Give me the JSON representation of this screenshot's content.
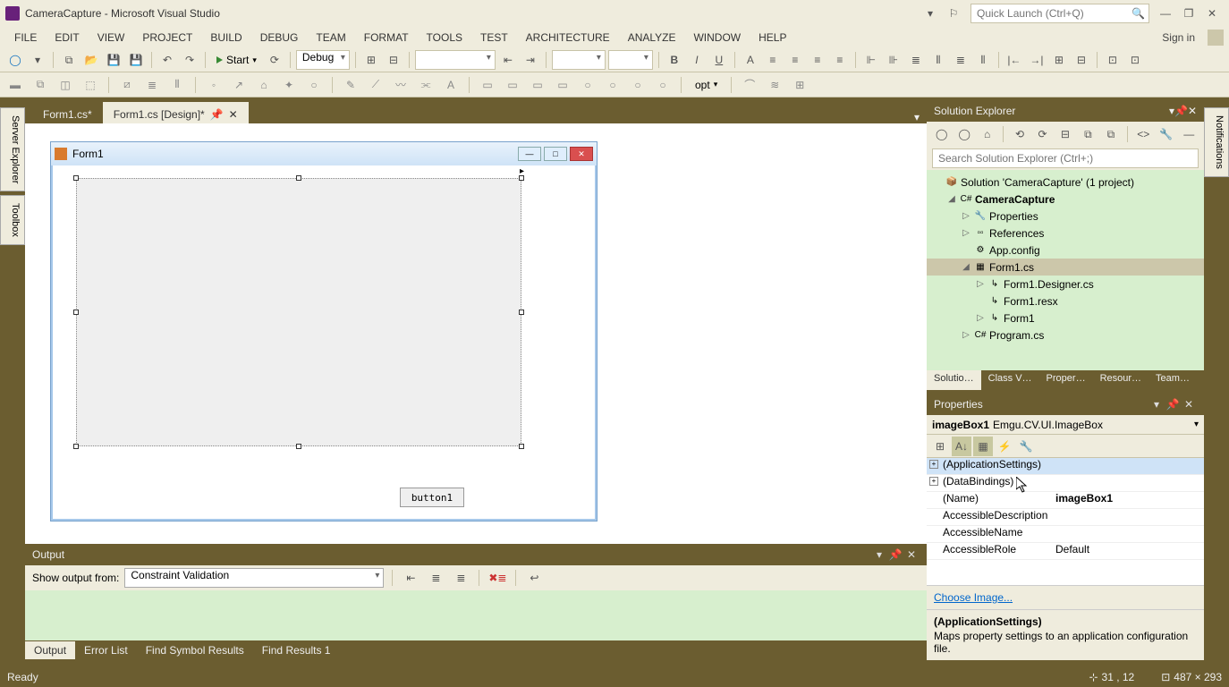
{
  "title": "CameraCapture - Microsoft Visual Studio",
  "quickLaunch": "Quick Launch (Ctrl+Q)",
  "signIn": "Sign in",
  "menu": [
    "FILE",
    "EDIT",
    "VIEW",
    "PROJECT",
    "BUILD",
    "DEBUG",
    "TEAM",
    "FORMAT",
    "TOOLS",
    "TEST",
    "ARCHITECTURE",
    "ANALYZE",
    "WINDOW",
    "HELP"
  ],
  "startLabel": "Start",
  "configCombo": "Debug",
  "optLabel": "opt",
  "sideTabs": {
    "server": "Server Explorer",
    "toolbox": "Toolbox",
    "notif": "Notifications"
  },
  "docTabs": [
    {
      "label": "Form1.cs*",
      "active": false
    },
    {
      "label": "Form1.cs [Design]*",
      "active": true
    }
  ],
  "form": {
    "title": "Form1",
    "button1": "button1"
  },
  "outputPanel": {
    "title": "Output",
    "showFrom": "Show output from:",
    "combo": "Constraint Validation"
  },
  "bottomTabs": [
    "Output",
    "Error List",
    "Find Symbol Results",
    "Find Results 1"
  ],
  "solutionExplorer": {
    "title": "Solution Explorer",
    "searchPlaceholder": "Search Solution Explorer (Ctrl+;)",
    "tree": [
      {
        "indent": 0,
        "exp": "",
        "icon": "📦",
        "label": "Solution 'CameraCapture' (1 project)",
        "bold": false,
        "sel": false
      },
      {
        "indent": 1,
        "exp": "◢",
        "icon": "C#",
        "label": "CameraCapture",
        "bold": true,
        "sel": false
      },
      {
        "indent": 2,
        "exp": "▷",
        "icon": "🔧",
        "label": "Properties",
        "bold": false,
        "sel": false
      },
      {
        "indent": 2,
        "exp": "▷",
        "icon": "▫▫",
        "label": "References",
        "bold": false,
        "sel": false
      },
      {
        "indent": 2,
        "exp": "",
        "icon": "⚙",
        "label": "App.config",
        "bold": false,
        "sel": false
      },
      {
        "indent": 2,
        "exp": "◢",
        "icon": "▦",
        "label": "Form1.cs",
        "bold": false,
        "sel": true
      },
      {
        "indent": 3,
        "exp": "▷",
        "icon": "↳",
        "label": "Form1.Designer.cs",
        "bold": false,
        "sel": false
      },
      {
        "indent": 3,
        "exp": "",
        "icon": "↳",
        "label": "Form1.resx",
        "bold": false,
        "sel": false
      },
      {
        "indent": 3,
        "exp": "▷",
        "icon": "↳",
        "label": "Form1",
        "bold": false,
        "sel": false
      },
      {
        "indent": 2,
        "exp": "▷",
        "icon": "C#",
        "label": "Program.cs",
        "bold": false,
        "sel": false
      }
    ],
    "tabs": [
      "Solutio…",
      "Class V…",
      "Proper…",
      "Resour…",
      "Team…"
    ]
  },
  "properties": {
    "title": "Properties",
    "object": "imageBox1",
    "objectType": "Emgu.CV.UI.ImageBox",
    "rows": [
      {
        "exp": "+",
        "name": "(ApplicationSettings)",
        "val": "",
        "sel": true
      },
      {
        "exp": "+",
        "name": "(DataBindings)",
        "val": ""
      },
      {
        "exp": "",
        "name": "(Name)",
        "val": "imageBox1",
        "bold": true
      },
      {
        "exp": "",
        "name": "AccessibleDescription",
        "val": ""
      },
      {
        "exp": "",
        "name": "AccessibleName",
        "val": ""
      },
      {
        "exp": "",
        "name": "AccessibleRole",
        "val": "Default"
      }
    ],
    "link": "Choose Image...",
    "descTitle": "(ApplicationSettings)",
    "descText": "Maps property settings to an application configuration file."
  },
  "status": {
    "ready": "Ready",
    "pos": "31 , 12",
    "size": "487 × 293"
  }
}
